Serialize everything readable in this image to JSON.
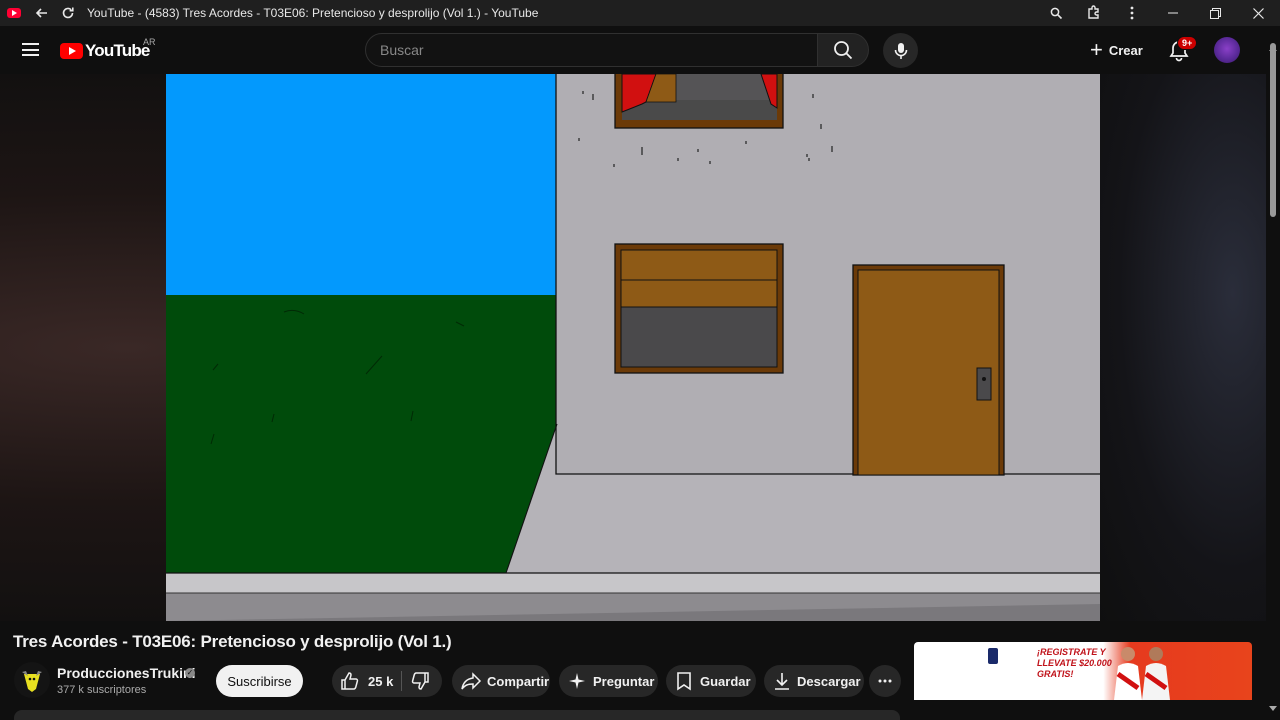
{
  "browser": {
    "tab_title": "YouTube - (4583) Tres Acordes - T03E06: Pretencioso y desprolijo (Vol 1.) - YouTube"
  },
  "header": {
    "logo_text": "YouTube",
    "country": "AR",
    "search_placeholder": "Buscar",
    "create_label": "Crear",
    "notification_badge": "9+"
  },
  "video": {
    "title": "Tres Acordes - T03E06: Pretencioso y desprolijo (Vol 1.)"
  },
  "channel": {
    "name": "ProduccionesTrukini",
    "subscribers": "377 k suscriptores",
    "subscribe_label": "Suscribirse"
  },
  "actions": {
    "like_count": "25 k",
    "share_label": "Compartir",
    "ask_label": "Preguntar",
    "save_label": "Guardar",
    "download_label": "Descargar"
  },
  "ad": {
    "line1": "¡REGISTRATE Y",
    "line2": "LLEVATE $20.000",
    "line3": "GRATIS!"
  },
  "colors": {
    "background": "#0f0f0f",
    "brand_red": "#ff0000",
    "sky": "#0399fd",
    "grass": "#004b0b",
    "wall": "#b0aeb3",
    "door": "#8e5a16"
  }
}
